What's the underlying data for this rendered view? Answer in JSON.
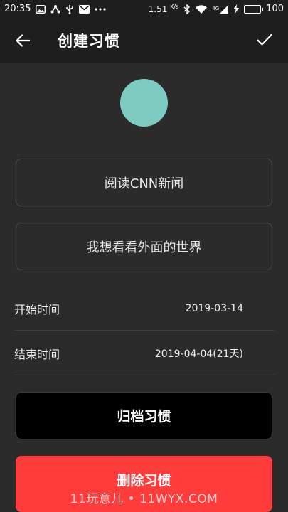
{
  "status_bar": {
    "time": "20:35",
    "network_speed": "1.51",
    "network_speed_unit": "K/s",
    "signal_label": "4G",
    "battery": "100",
    "icons": [
      "image-icon",
      "share-icon",
      "usb-icon",
      "mail-icon",
      "more-icon",
      "bluetooth-icon",
      "wifi-icon",
      "signal-icon",
      "charging-icon",
      "battery-icon"
    ]
  },
  "app_bar": {
    "title": "创建习惯",
    "back_icon": "arrow-left-icon",
    "confirm_icon": "check-icon"
  },
  "habit": {
    "color": "#7ecbc1",
    "name": "阅读CNN新闻",
    "description": "我想看看外面的世界"
  },
  "dates": {
    "start_label": "开始时间",
    "start_value": "2019-03-14",
    "end_label": "结束时间",
    "end_value": "2019-04-04(21天)"
  },
  "actions": {
    "archive_label": "归档习惯",
    "delete_label": "删除习惯"
  },
  "watermark": "11玩意儿 • 11WYX.COM",
  "colors": {
    "background": "#2b2b2b",
    "app_bar": "#1e1e1e",
    "archive_button": "#000000",
    "delete_button": "#fe3c3c"
  }
}
